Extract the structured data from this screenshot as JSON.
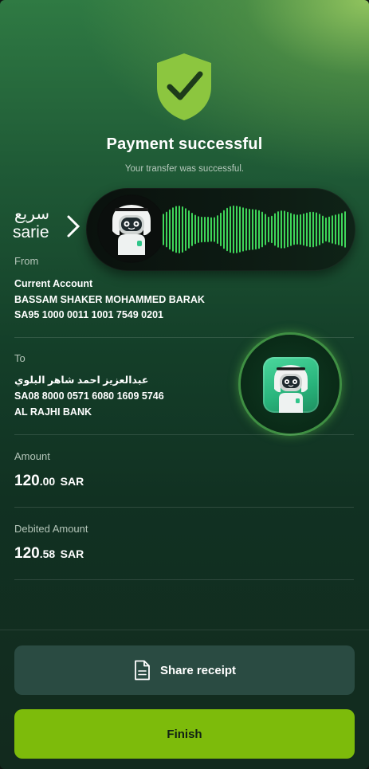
{
  "header": {
    "title": "Payment successful",
    "subtitle": "Your transfer was successful."
  },
  "brand": {
    "logo_arabic": "سريع",
    "logo_latin": "sarie"
  },
  "from": {
    "label": "From",
    "account_type": "Current Account",
    "name": "BASSAM SHAKER MOHAMMED BARAK",
    "iban": "SA95 1000 0011 1001 7549 0201"
  },
  "to": {
    "label": "To",
    "name": "عبدالعزيز احمد شاهر البلوي",
    "iban": "SA08 8000 0571 6080 1609 5746",
    "bank": "AL RAJHI BANK"
  },
  "amount": {
    "label": "Amount",
    "integer": "120",
    "decimal": ".00",
    "currency": "SAR"
  },
  "debited": {
    "label": "Debited Amount",
    "integer": "120",
    "decimal": ".58",
    "currency": "SAR"
  },
  "actions": {
    "share_label": "Share receipt",
    "finish_label": "Finish"
  },
  "icons": {
    "success": "shield-check-icon",
    "share": "document-icon",
    "voice_avatar": "robot-avatar",
    "voice_wave": "audio-waveform",
    "assistant": "robot-assistant-icon"
  },
  "colors": {
    "accent": "#7dbb0b",
    "shield": "#8cc63f",
    "share_button": "#2a4b42",
    "waveform": "#3fd65a"
  }
}
